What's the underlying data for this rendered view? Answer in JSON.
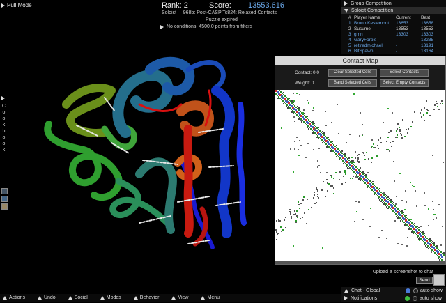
{
  "toolbar": {
    "pull_mode": "Pull Mode"
  },
  "score_panel": {
    "rank_label": "Rank: 2",
    "score_label": "Score:",
    "score_value": "13553.616",
    "mode": "Soloist",
    "puzzle": "968b: Post-CASP Tc824: Relaxed Contacts",
    "status": "Puzzle expired",
    "conditions": "No conditions. 4500.0 points from filters"
  },
  "cookbook": {
    "label": "Cookbook"
  },
  "competition": {
    "group_tab": "Group Competition",
    "soloist_tab": "Soloist Competition",
    "headers": [
      "#",
      "Player Name",
      "Current",
      "Best"
    ],
    "rows": [
      {
        "rank": "1",
        "name": "Bruno Kestemont",
        "current": "13653",
        "best": "13658",
        "highlight": true
      },
      {
        "rank": "2",
        "name": "Susume",
        "current": "13553",
        "best": "13553",
        "highlight": false
      },
      {
        "rank": "3",
        "name": "gmn",
        "current": "13303",
        "best": "13303",
        "highlight": true
      },
      {
        "rank": "4",
        "name": "GaryForbis",
        "current": "-",
        "best": "13235",
        "highlight": true
      },
      {
        "rank": "5",
        "name": "retiredmichael",
        "current": "-",
        "best": "13191",
        "highlight": true
      },
      {
        "rank": "6",
        "name": "BitSpawn",
        "current": "-",
        "best": "13164",
        "highlight": true
      }
    ]
  },
  "contact_map": {
    "title": "Contact Map",
    "contact_label": "Contact: 0.0",
    "weight_label": "Weight: 0",
    "btn_clear": "Clear Selected Cells",
    "btn_select": "Select Contacts",
    "btn_band": "Band Selected Cells",
    "btn_empty": "Select Empty Contacts"
  },
  "chat": {
    "upload": "Upload a screenshot to chat",
    "send": "Send",
    "global": "Chat - Global",
    "notifications": "Notifications",
    "auto_show": "auto show"
  },
  "bottom_menu": [
    "Actions",
    "Undo",
    "Social",
    "Modes",
    "Behavior",
    "View",
    "Menu"
  ],
  "colors": {
    "accent": "#6aa7e8",
    "highlight_name": "#6aa7e8",
    "panel": "#0c0c0c"
  },
  "icons": [
    "triangle-right-icon",
    "triangle-up-icon",
    "camera-icon",
    "info-icon"
  ]
}
